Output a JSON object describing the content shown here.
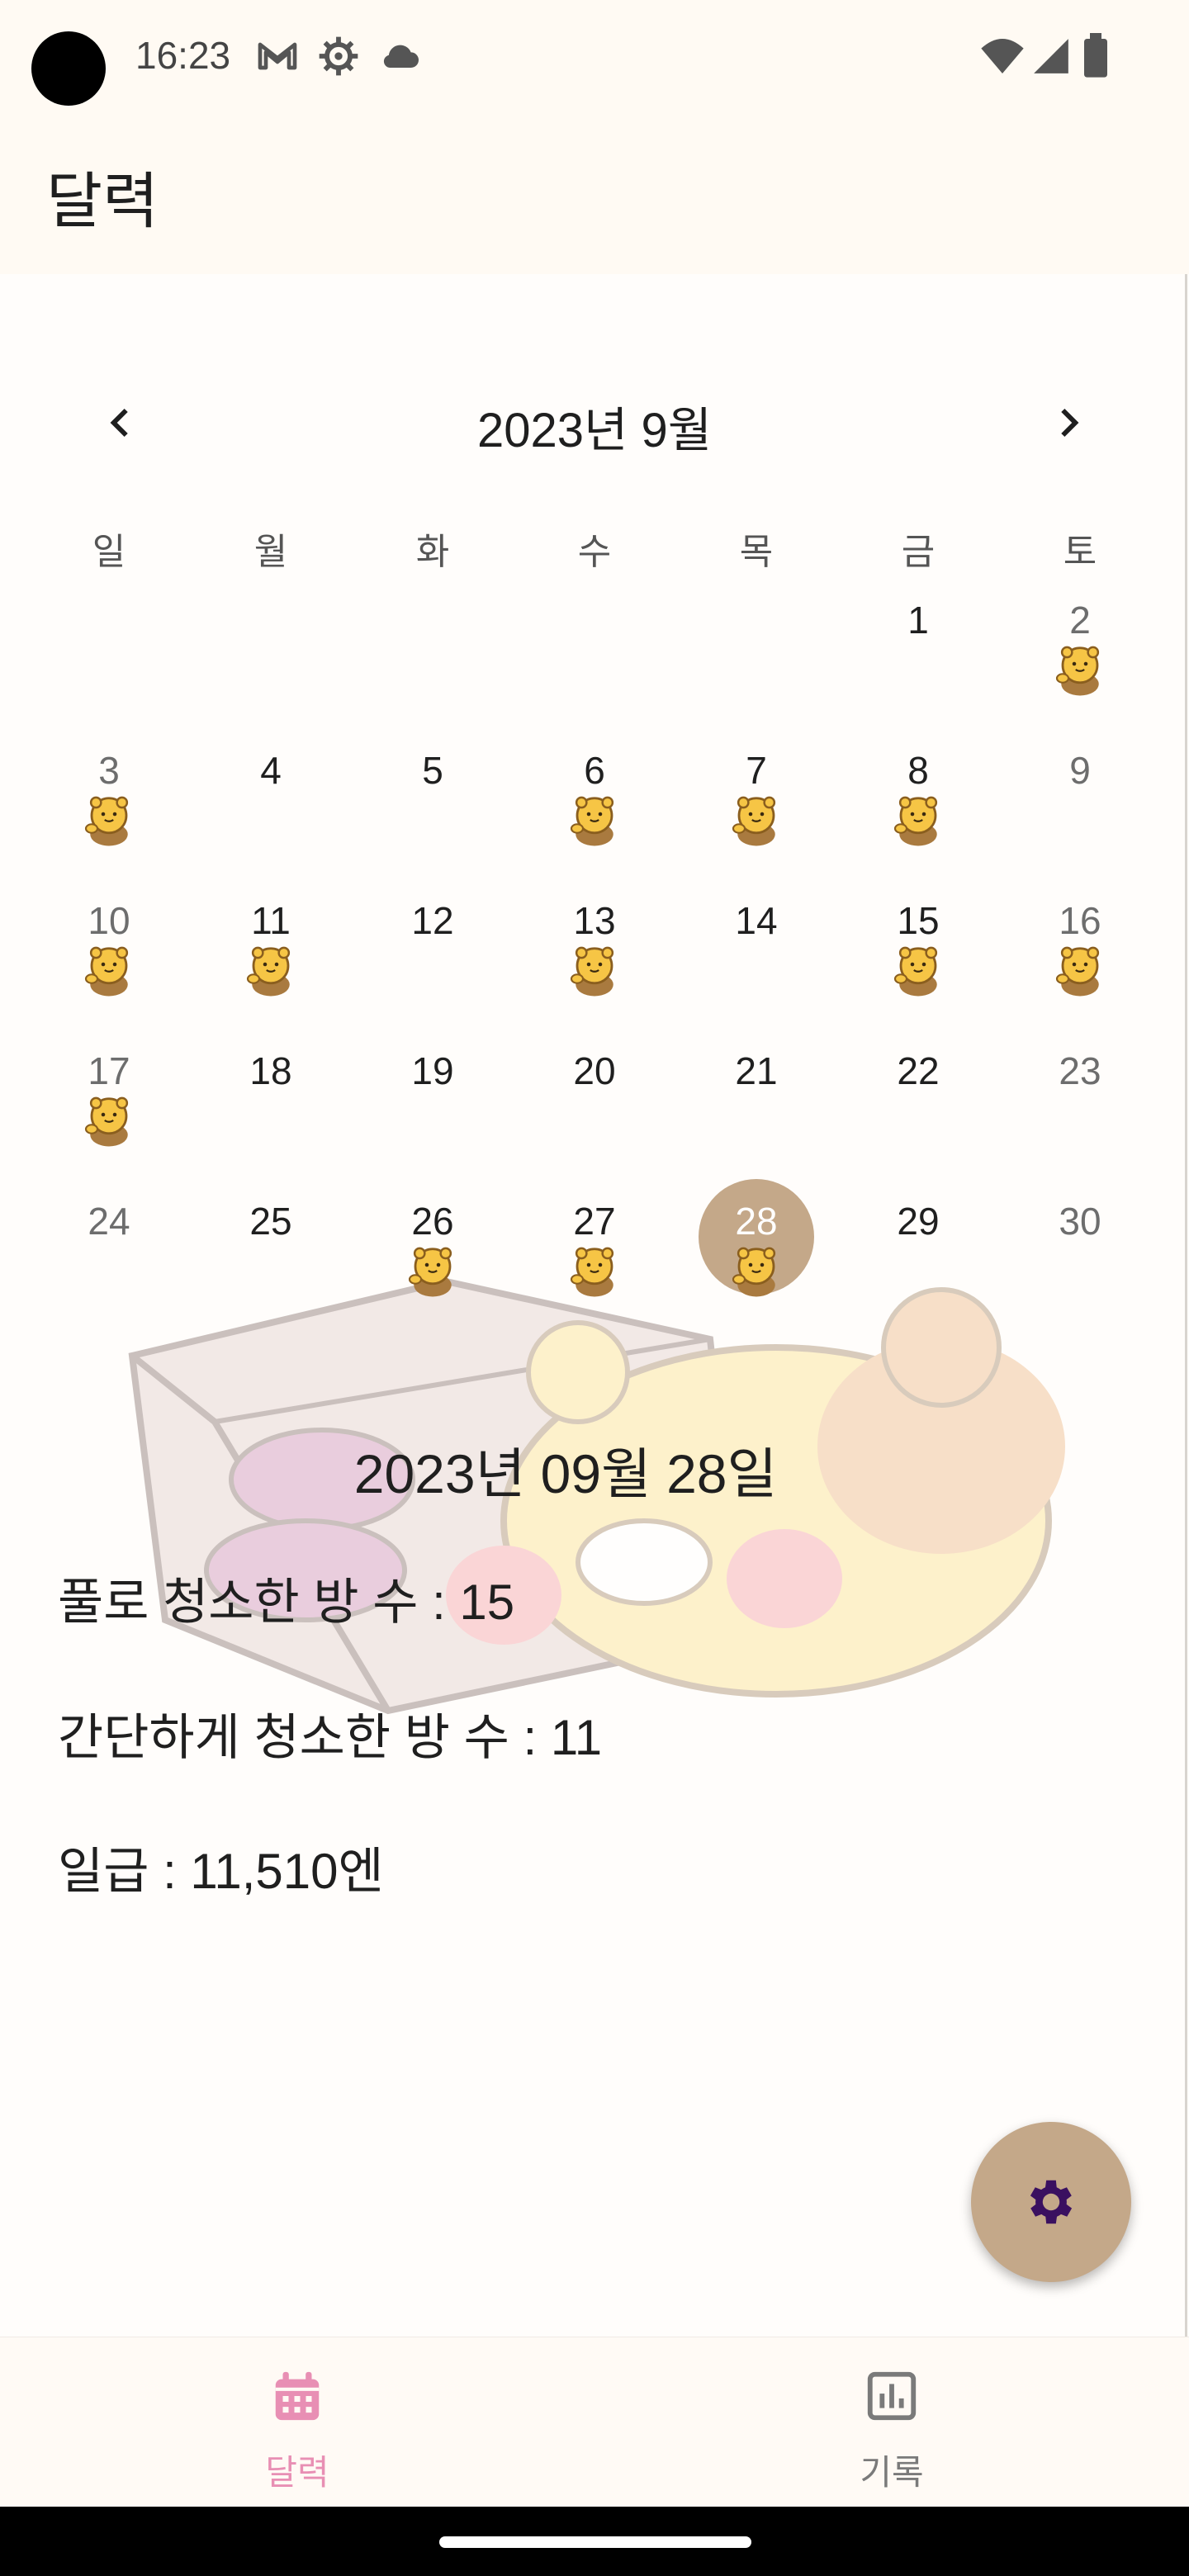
{
  "status_bar": {
    "time": "16:23",
    "icons": [
      "gmail-icon",
      "settings-gear-icon",
      "cloud-icon",
      "wifi-icon",
      "signal-icon",
      "battery-icon"
    ]
  },
  "app_bar": {
    "title": "달력"
  },
  "calendar": {
    "month_title": "2023년 9월",
    "prev_icon": "chevron-left-icon",
    "next_icon": "chevron-right-icon",
    "weekdays": [
      "일",
      "월",
      "화",
      "수",
      "목",
      "금",
      "토"
    ],
    "weeks": [
      [
        "",
        "",
        "",
        "",
        "",
        "1",
        "2"
      ],
      [
        "3",
        "4",
        "5",
        "6",
        "7",
        "8",
        "9"
      ],
      [
        "10",
        "11",
        "12",
        "13",
        "14",
        "15",
        "16"
      ],
      [
        "17",
        "18",
        "19",
        "20",
        "21",
        "22",
        "23"
      ],
      [
        "24",
        "25",
        "26",
        "27",
        "28",
        "29",
        "30"
      ]
    ],
    "days_with_sticker": [
      2,
      3,
      6,
      7,
      8,
      10,
      11,
      13,
      15,
      16,
      17,
      26,
      27,
      28
    ],
    "selected_day": 28,
    "sticker_icon": "bear-character-icon"
  },
  "detail": {
    "date": "2023년 09월 28일",
    "full_clean": "풀로 청소한 방 수 : 15",
    "quick_clean": "간단하게 청소한 방 수 : 11",
    "daily_pay": "일급 : 11,510엔"
  },
  "fab": {
    "icon": "settings-gear-icon"
  },
  "bottom_nav": {
    "items": [
      {
        "label": "달력",
        "icon": "calendar-icon",
        "active": true
      },
      {
        "label": "기록",
        "icon": "bar-chart-icon",
        "active": false
      }
    ]
  },
  "colors": {
    "accent_pink": "#e88fb4",
    "selected_day": "#c4a889",
    "fab_icon": "#3a1060",
    "inactive_nav": "#7a7a7a"
  }
}
